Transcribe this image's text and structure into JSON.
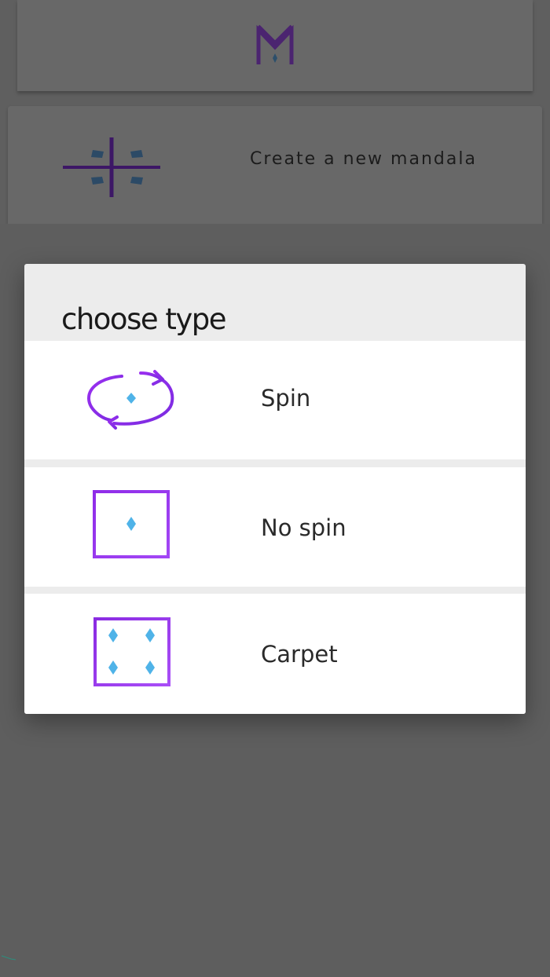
{
  "background": {
    "create_card": {
      "label": "Create a new mandala"
    }
  },
  "dialog": {
    "title": "choose type",
    "options": [
      {
        "label": "Spin",
        "icon": "spin-icon"
      },
      {
        "label": "No spin",
        "icon": "no-spin-icon"
      },
      {
        "label": "Carpet",
        "icon": "carpet-icon"
      }
    ]
  },
  "colors": {
    "scrim": "#5f5f5f",
    "dialog_header": "#ececec",
    "option_bg": "#ffffff",
    "icon_purple": "#8a2be2",
    "icon_blue": "#4fb3e8",
    "logo_purple": "#5b2a86",
    "cross_purple": "#3d1766",
    "cross_blue": "#2c4a66"
  }
}
